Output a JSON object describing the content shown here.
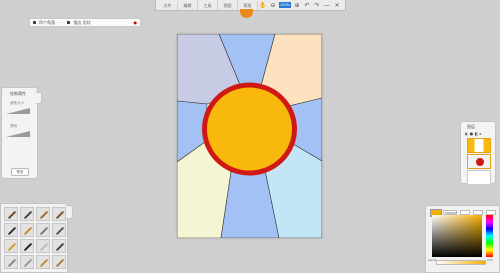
{
  "toolbar": {
    "menu": [
      "文件",
      "编辑",
      "工具",
      "视图",
      "帮助"
    ],
    "zoom": "100%",
    "icons": [
      "pan-icon",
      "zoom-out-icon",
      "zoom-in-icon",
      "undo-icon",
      "redo-icon",
      "minimize-icon",
      "close-icon"
    ]
  },
  "props_bar": {
    "label_1": "四个角落",
    "label_2": "描边 形状"
  },
  "left_panel": {
    "title": "绘制属性",
    "slider1_label": "画笔大小",
    "slider2_label": "透明",
    "preview_label": "预览"
  },
  "layers_panel": {
    "title": "图层"
  },
  "color_panel": {
    "hex": "F0B000",
    "alpha_label": "alpha",
    "alpha_value": "100",
    "colors": {
      "swatch": "#f0b000"
    }
  },
  "artwork": {
    "colors": {
      "lavender": "#c7cbe4",
      "blue": "#a4c1f5",
      "peach": "#fde2c0",
      "cream": "#f4f5d2",
      "light_blue": "#c3e6f7",
      "sun_fill": "#f9b90c",
      "sun_ring": "#cf1a14"
    }
  }
}
